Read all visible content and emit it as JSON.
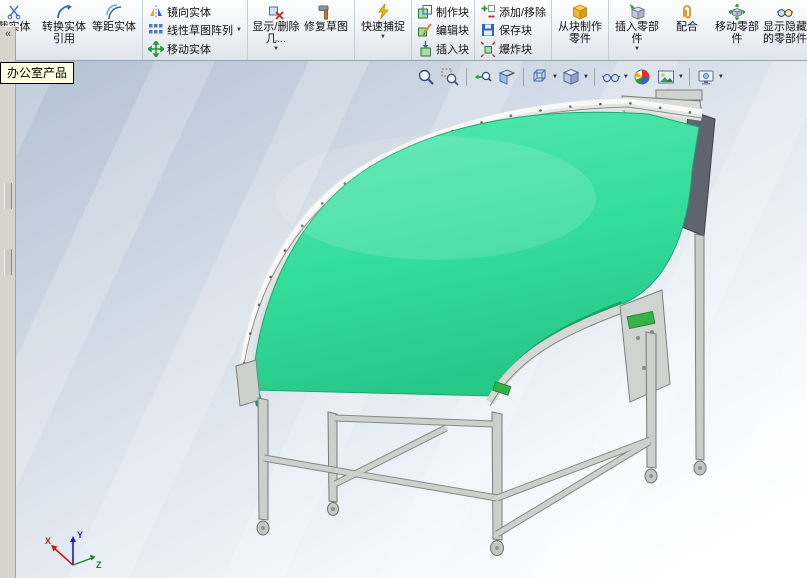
{
  "colors": {
    "belt_green": "#35dd9c",
    "belt_green_dark": "#17995f",
    "frame_gray": "#ccd0cc",
    "viewport_top": "#b2c0d2",
    "tooltip_bg": "#ffffe1",
    "accent_blue": "#3a62c0"
  },
  "icons": {
    "collapse": "«",
    "dropdown": "▼"
  },
  "tooltip": {
    "text": "办公室产品"
  },
  "ribbon": {
    "trim": {
      "label": "裁实体"
    },
    "convert": {
      "label": "转换实体引用"
    },
    "offset": {
      "label": "等距实体"
    },
    "mirror": {
      "label": "镜向实体"
    },
    "linear_pattern": {
      "label": "线性草图阵列"
    },
    "move_entities": {
      "label": "移动实体"
    },
    "display_delete": {
      "label": "显示/删除几..."
    },
    "repair_sketch": {
      "label": "修复草图"
    },
    "quick_snap": {
      "label": "快速捕捉"
    },
    "make_block": {
      "label": "制作块"
    },
    "edit_block": {
      "label": "编辑块"
    },
    "insert_block": {
      "label": "插入块"
    },
    "add_remove": {
      "label": "添加/移除"
    },
    "save_block": {
      "label": "保存块"
    },
    "explode_block": {
      "label": "爆炸块"
    },
    "make_part_from_block": {
      "label": "从块制作零件"
    },
    "insert_component": {
      "label": "插入零部件"
    },
    "mate": {
      "label": "配合"
    },
    "move_component": {
      "label": "移动零部件"
    },
    "show_hidden": {
      "label": "显示隐藏的零部件"
    }
  },
  "view_toolbar": {
    "tools": [
      "zoom-to-fit",
      "zoom-to-area",
      "previous-view",
      "section-view",
      "view-orientation",
      "display-style",
      "hide-show-items",
      "edit-appearance",
      "apply-scene",
      "view-settings"
    ]
  },
  "triad": {
    "x": "X",
    "y": "Y",
    "z": "Z"
  }
}
